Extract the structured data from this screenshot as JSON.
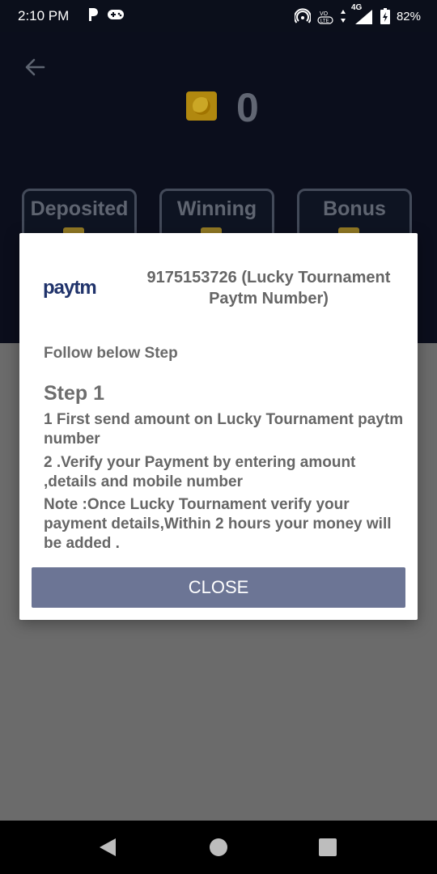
{
  "status_bar": {
    "time": "2:10 PM",
    "left_icons": [
      "parking-p-icon",
      "gamepad-icon"
    ],
    "right_icons": [
      "hotspot-icon",
      "volte-icon",
      "data-arrows-icon",
      "signal-icon",
      "battery-charging-icon"
    ],
    "network_label": "4G",
    "battery": "82%"
  },
  "header": {
    "back_icon": "arrow-left-icon",
    "coin_icon": "coin-icon",
    "balance": "0"
  },
  "wallet": {
    "cards": [
      {
        "label": "Deposited"
      },
      {
        "label": "Winning"
      },
      {
        "label": "Bonus"
      }
    ]
  },
  "dialog": {
    "logo_text": "paytm",
    "paytm_number": "9175153726 (Lucky Tournament Paytm Number)",
    "follow_text": "Follow below Step",
    "step_title": "Step 1",
    "step_lines": [
      "1 First send amount on Lucky Tournament paytm number",
      "2 .Verify your Payment by entering amount ,details and mobile number",
      "Note :Once Lucky Tournament verify your payment details,Within 2 hours your money will be added ."
    ],
    "close_label": "CLOSE"
  },
  "nav": {
    "icons": [
      "back-triangle-icon",
      "home-circle-icon",
      "recents-square-icon"
    ]
  },
  "colors": {
    "top_background": "#0d1120",
    "dialog_button": "#6c7595",
    "paytm_blue": "#00b9f1",
    "paytm_navy": "#20336b"
  }
}
